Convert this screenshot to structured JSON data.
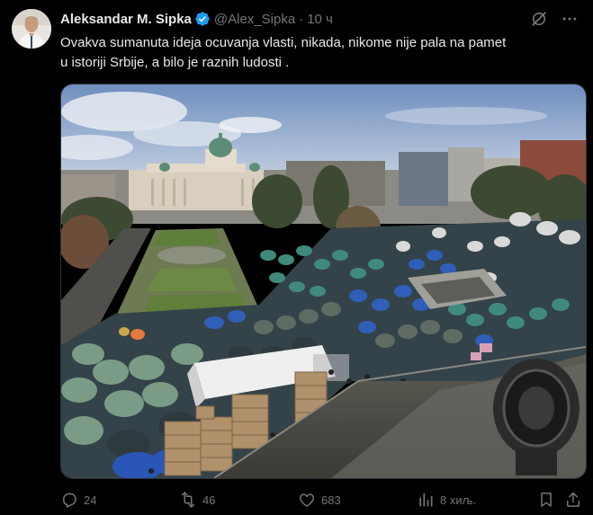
{
  "tweet": {
    "display_name": "Aleksandar M. Sipka",
    "handle": "@Alex_Sipka",
    "separator": "·",
    "time": "10 ч",
    "text_line1": "Ovakva sumanuta ideja ocuvanja vlasti, nikada, nikome nije pala na pamet",
    "text_line2": "u istoriji Srbije, a bilo je raznih ludosti ."
  },
  "actions": {
    "replies": "24",
    "reposts": "46",
    "likes": "683",
    "views": "8 хиљ."
  },
  "icons": {
    "verified": "verified-badge-icon",
    "grok": "grok-icon",
    "more": "more-icon",
    "reply": "reply-icon",
    "repost": "repost-icon",
    "like": "like-icon",
    "views": "views-icon",
    "bookmark": "bookmark-icon",
    "share": "share-icon"
  },
  "colors": {
    "background": "#000000",
    "text": "#e7e9ea",
    "secondary": "#71767b",
    "verified": "#1d9bf0"
  }
}
